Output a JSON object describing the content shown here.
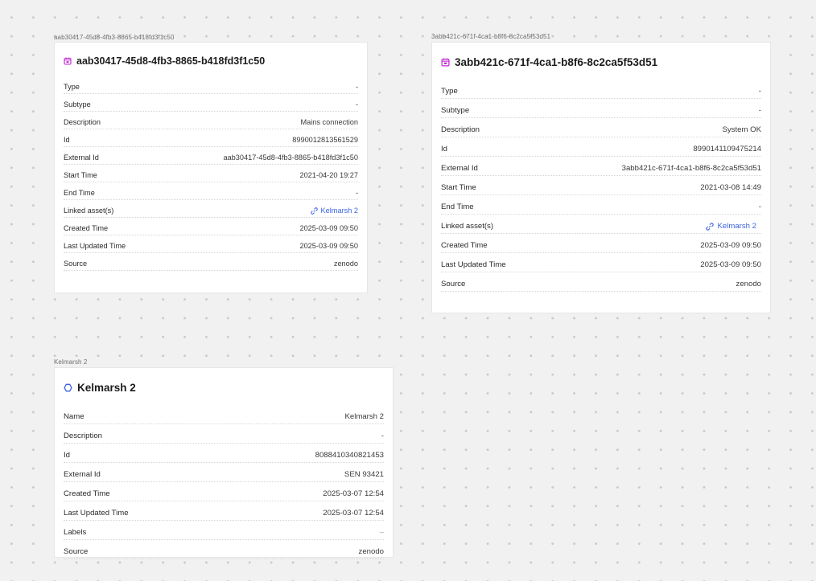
{
  "colors": {
    "accent_link": "#3b63e0",
    "event_icon": "#c026d3",
    "asset_icon": "#3b63e0",
    "canvas": "#f1f1f1"
  },
  "cards": [
    {
      "frame_label": "aab30417-45d8-4fb3-8865-b418fd3f1c50",
      "icon": "calendar-event-icon",
      "title": "aab30417-45d8-4fb3-8865-b418fd3f1c50",
      "rows": [
        {
          "key": "Type",
          "value": "-"
        },
        {
          "key": "Subtype",
          "value": "-"
        },
        {
          "key": "Description",
          "value": "Mains connection"
        },
        {
          "key": "Id",
          "value": "8990012813561529"
        },
        {
          "key": "External Id",
          "value": "aab30417-45d8-4fb3-8865-b418fd3f1c50"
        },
        {
          "key": "Start Time",
          "value": "2021-04-20 19:27"
        },
        {
          "key": "End Time",
          "value": "-"
        },
        {
          "key": "Linked asset(s)",
          "value": "Kelmarsh 2",
          "link": true
        },
        {
          "key": "Created Time",
          "value": "2025-03-09 09:50"
        },
        {
          "key": "Last Updated Time",
          "value": "2025-03-09 09:50"
        },
        {
          "key": "Source",
          "value": "zenodo"
        }
      ]
    },
    {
      "frame_label": "3abb421c-671f-4ca1-b8f6-8c2ca5f53d51",
      "icon": "calendar-event-icon",
      "title": "3abb421c-671f-4ca1-b8f6-8c2ca5f53d51",
      "rows": [
        {
          "key": "Type",
          "value": "-"
        },
        {
          "key": "Subtype",
          "value": "-"
        },
        {
          "key": "Description",
          "value": "System OK"
        },
        {
          "key": "Id",
          "value": "8990141109475214"
        },
        {
          "key": "External Id",
          "value": "3abb421c-671f-4ca1-b8f6-8c2ca5f53d51"
        },
        {
          "key": "Start Time",
          "value": "2021-03-08 14:49"
        },
        {
          "key": "End Time",
          "value": "-"
        },
        {
          "key": "Linked asset(s)",
          "value": "Kelmarsh 2",
          "link": true
        },
        {
          "key": "Created Time",
          "value": "2025-03-09 09:50"
        },
        {
          "key": "Last Updated Time",
          "value": "2025-03-09 09:50"
        },
        {
          "key": "Source",
          "value": "zenodo"
        }
      ]
    },
    {
      "frame_label": "Kelmarsh 2",
      "icon": "asset-hexagon-icon",
      "title": "Kelmarsh 2",
      "rows": [
        {
          "key": "Name",
          "value": "Kelmarsh 2"
        },
        {
          "key": "Description",
          "value": "-"
        },
        {
          "key": "Id",
          "value": "8088410340821453"
        },
        {
          "key": "External Id",
          "value": "SEN 93421"
        },
        {
          "key": "Created Time",
          "value": "2025-03-07 12:54"
        },
        {
          "key": "Last Updated Time",
          "value": "2025-03-07 12:54"
        },
        {
          "key": "Labels",
          "value": "–",
          "muted": true
        },
        {
          "key": "Source",
          "value": "zenodo"
        }
      ]
    }
  ]
}
